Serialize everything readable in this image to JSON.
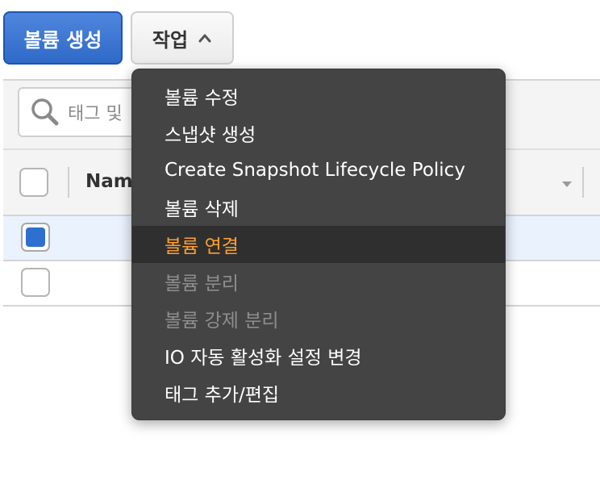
{
  "toolbar": {
    "create_volume_label": "볼륨 생성",
    "actions_label": "작업"
  },
  "search": {
    "placeholder": "태그 및"
  },
  "table": {
    "columns": [
      "Name"
    ],
    "rows": [
      {
        "selected": true
      },
      {
        "selected": false
      }
    ]
  },
  "menu": {
    "items": [
      {
        "label": "볼륨 수정",
        "state": "enabled"
      },
      {
        "label": "스냅샷 생성",
        "state": "enabled"
      },
      {
        "label": "Create Snapshot Lifecycle Policy",
        "state": "enabled"
      },
      {
        "label": "볼륨 삭제",
        "state": "enabled"
      },
      {
        "label": "볼륨 연결",
        "state": "highlighted"
      },
      {
        "label": "볼륨 분리",
        "state": "disabled"
      },
      {
        "label": "볼륨 강제 분리",
        "state": "disabled"
      },
      {
        "label": "IO 자동 활성화 설정 변경",
        "state": "enabled"
      },
      {
        "label": "태그 추가/편집",
        "state": "enabled"
      }
    ]
  },
  "colors": {
    "primary_button": "#2f6ac7",
    "menu_background": "#444444",
    "menu_highlight_text": "#ff9f2e",
    "selected_row": "#eaf2fd"
  },
  "icons": {
    "actions_caret": "chevron-up-icon",
    "search": "search-icon",
    "sort": "sort-down-icon"
  }
}
